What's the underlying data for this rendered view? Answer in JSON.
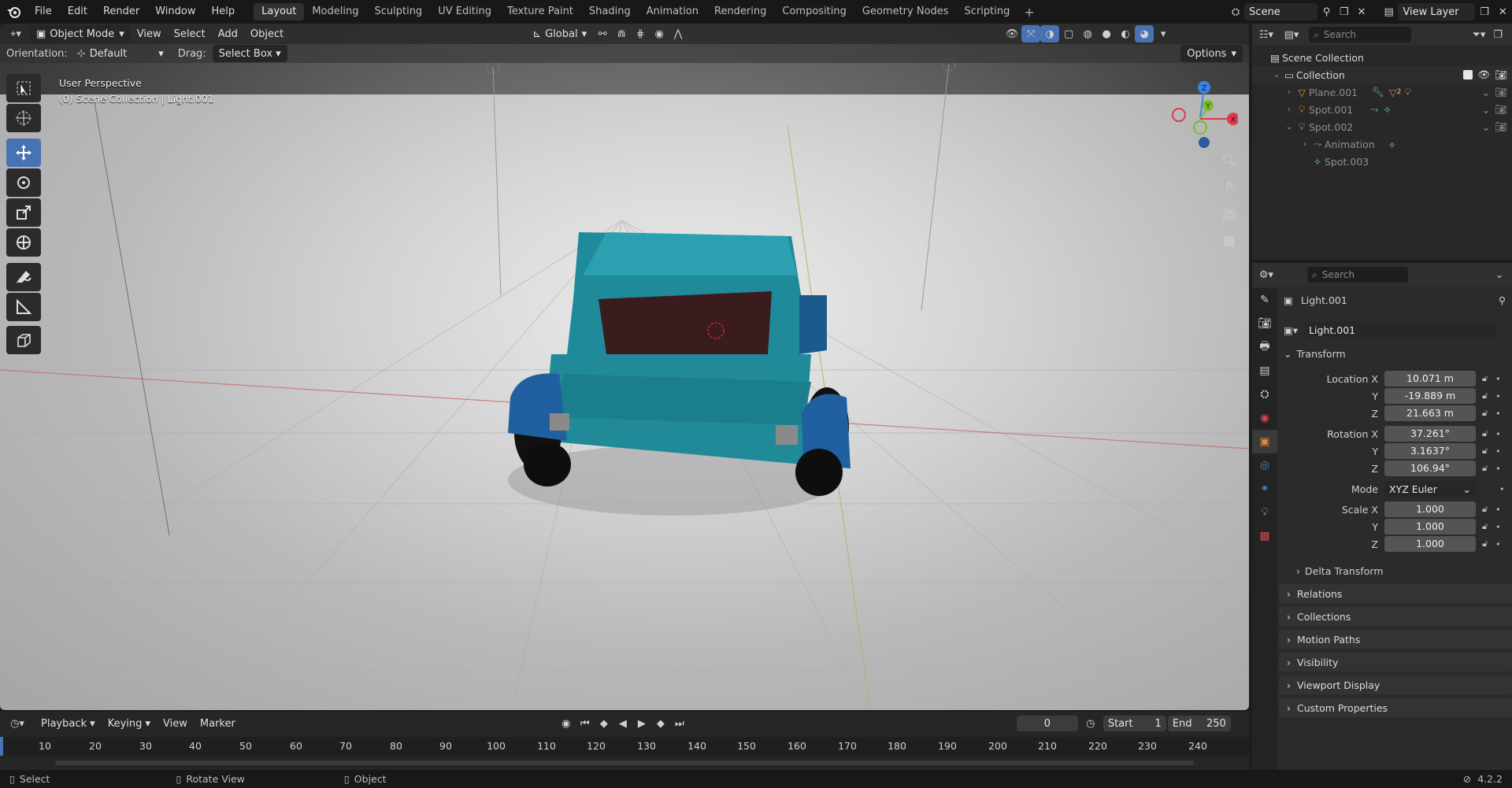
{
  "topbar": {
    "menus": [
      "File",
      "Edit",
      "Render",
      "Window",
      "Help"
    ],
    "workspaces": [
      "Layout",
      "Modeling",
      "Sculpting",
      "UV Editing",
      "Texture Paint",
      "Shading",
      "Animation",
      "Rendering",
      "Compositing",
      "Geometry Nodes",
      "Scripting"
    ],
    "active_workspace": "Layout",
    "scene": "Scene",
    "view_layer": "View Layer"
  },
  "viewport": {
    "mode": "Object Mode",
    "menus": [
      "View",
      "Select",
      "Add",
      "Object"
    ],
    "orientation_transform": "Global",
    "orientation_label": "Orientation:",
    "orientation_value": "Default",
    "drag_label": "Drag:",
    "drag_value": "Select Box",
    "options": "Options",
    "overlay_line1": "User Perspective",
    "overlay_line2": "(0) Scene Collection | Light.001",
    "gizmo_axes": {
      "x": "X",
      "y": "Y",
      "z": "Z"
    }
  },
  "outliner": {
    "search_placeholder": "Search",
    "rows": [
      {
        "label": "Scene Collection",
        "icon": "scene-collection-icon",
        "dim": false
      },
      {
        "label": "Collection",
        "icon": "collection-icon",
        "dim": false
      },
      {
        "label": "Plane.001",
        "icon": "mesh-icon",
        "dim": true
      },
      {
        "label": "Spot.001",
        "icon": "light-icon",
        "dim": true
      },
      {
        "label": "Spot.002",
        "icon": "light-icon",
        "dim": true
      },
      {
        "label": "Animation",
        "icon": "animation-icon",
        "dim": true
      },
      {
        "label": "Spot.003",
        "icon": "light-data-icon",
        "dim": true
      }
    ],
    "plane_badge": "2"
  },
  "properties": {
    "search_placeholder": "Search",
    "object_name": "Light.001",
    "data_name": "Light.001",
    "transform_title": "Transform",
    "location": {
      "label": "Location X",
      "x": "10.071 m",
      "y": "-19.889 m",
      "z": "21.663 m"
    },
    "rotation": {
      "label": "Rotation X",
      "x": "37.261°",
      "y": "3.1637°",
      "z": "106.94°"
    },
    "mode_label": "Mode",
    "mode_value": "XYZ Euler",
    "scale": {
      "label": "Scale X",
      "x": "1.000",
      "y": "1.000",
      "z": "1.000"
    },
    "axis_y": "Y",
    "axis_z": "Z",
    "delta_transform": "Delta Transform",
    "panels": [
      "Relations",
      "Collections",
      "Motion Paths",
      "Visibility",
      "Viewport Display",
      "Custom Properties"
    ]
  },
  "timeline": {
    "menus": [
      "Playback",
      "Keying",
      "View",
      "Marker"
    ],
    "current_frame": "0",
    "start_label": "Start",
    "start_value": "1",
    "end_label": "End",
    "end_value": "250",
    "ruler": [
      "10",
      "20",
      "30",
      "40",
      "50",
      "60",
      "70",
      "80",
      "90",
      "100",
      "110",
      "120",
      "130",
      "140",
      "150",
      "160",
      "170",
      "180",
      "190",
      "200",
      "210",
      "220",
      "230",
      "240"
    ]
  },
  "statusbar": {
    "select": "Select",
    "rotate": "Rotate View",
    "object": "Object",
    "version": "4.2.2"
  },
  "colors": {
    "accent": "#4772b3",
    "car_body": "#1f8a9a",
    "x_axis": "#e0394f",
    "y_axis": "#7cbc2a",
    "z_axis": "#3b84e0",
    "header_bg": "#181818"
  }
}
